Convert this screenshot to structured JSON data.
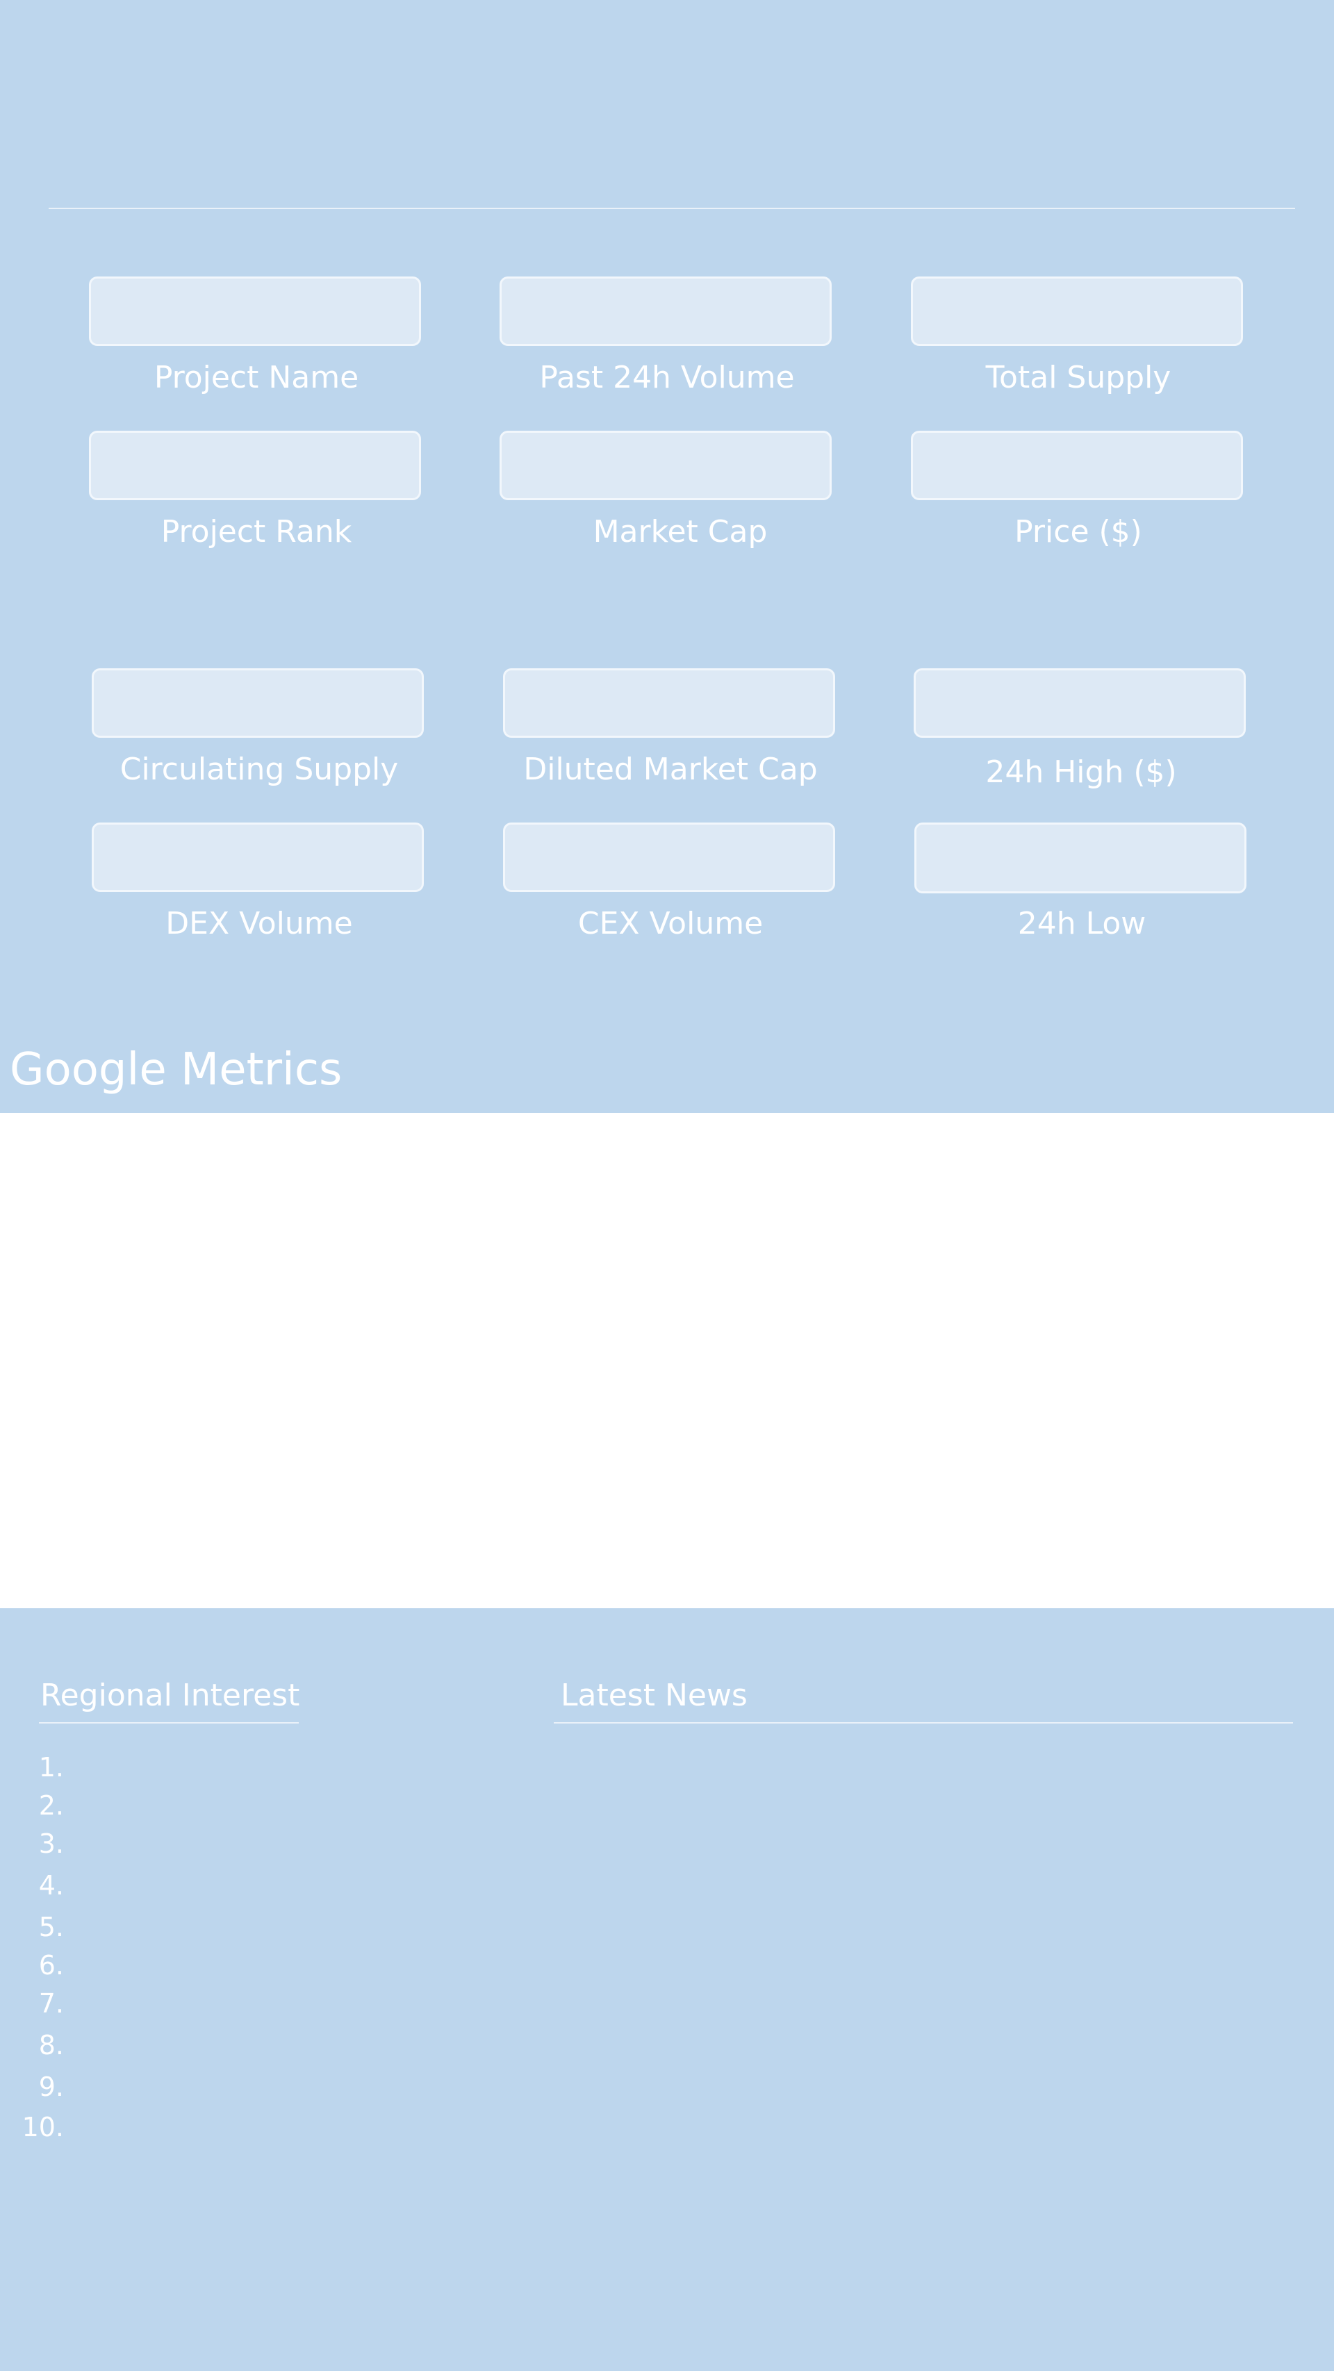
{
  "metrics_group1": {
    "project_name": "Project Name",
    "past_24h_volume": "Past 24h Volume",
    "total_supply": "Total Supply",
    "project_rank": "Project Rank",
    "market_cap": "Market Cap",
    "price": "Price ($)"
  },
  "metrics_group2": {
    "circulating_supply": "Circulating Supply",
    "diluted_market_cap": "Diluted Market Cap",
    "high_24h": "24h High ($)",
    "dex_volume": "DEX Volume",
    "cex_volume": "CEX Volume",
    "low_24h": "24h Low"
  },
  "google_metrics": {
    "title": "Google Metrics"
  },
  "regional_interest": {
    "title": "Regional Interest",
    "ranks": [
      "1.",
      "2.",
      "3.",
      "4.",
      "5.",
      "6.",
      "7.",
      "8.",
      "9.",
      "10."
    ]
  },
  "latest_news": {
    "title": "Latest News"
  }
}
